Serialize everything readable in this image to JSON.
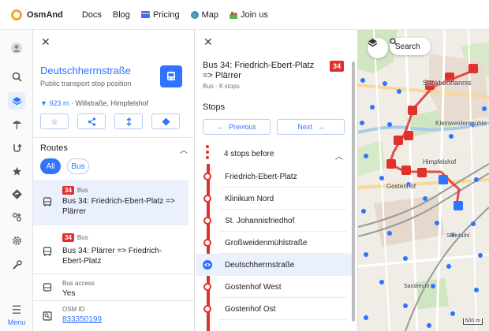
{
  "nav": {
    "brand": "OsmAnd",
    "links": [
      {
        "label": "Docs"
      },
      {
        "label": "Blog"
      },
      {
        "label": "Pricing"
      },
      {
        "label": "Map"
      },
      {
        "label": "Join us"
      }
    ]
  },
  "rail": {
    "menu_label": "Menu",
    "icons": [
      "account-icon",
      "search-icon",
      "layers-icon",
      "weather-icon",
      "route-icon",
      "favorite-icon",
      "navigation-icon",
      "plugins-icon",
      "settings-icon",
      "tools-icon"
    ]
  },
  "stop_panel": {
    "title": "Deutschherrnstraße",
    "subtitle": "Public transport stop position",
    "distance_value": "923 m",
    "distance_rest": " · Willstraße, Himpfelshof",
    "routes_heading": "Routes",
    "filter_all": "All",
    "filter_bus": "Bus",
    "routes": [
      {
        "badge": "34",
        "type": "Bus",
        "name_line1": "Bus 34: Friedrich-Ebert-Platz =>",
        "name_line2": "Plärrer"
      },
      {
        "badge": "34",
        "type": "Bus",
        "name_line1": "Bus 34: Plärrer => Friedrich-",
        "name_line2": "Ebert-Platz"
      }
    ],
    "properties": [
      {
        "label": "Bus access",
        "value": "Yes"
      },
      {
        "label": "OSM ID",
        "value": "833350199"
      }
    ]
  },
  "route_panel": {
    "title": "Bus 34: Friedrich-Ebert-Platz => Plärrer",
    "badge": "34",
    "meta": "Bus · 8 stops",
    "stops_heading": "Stops",
    "previous": "Previous",
    "next": "Next",
    "stops_before": "4 stops before",
    "stops": [
      {
        "name": "Friedrich-Ebert-Platz",
        "current": false
      },
      {
        "name": "Klinikum Nord",
        "current": false
      },
      {
        "name": "St. Johannisfriedhof",
        "current": false
      },
      {
        "name": "Großweidenmühlstraße",
        "current": false
      },
      {
        "name": "Deutschherrnstraße",
        "current": true
      },
      {
        "name": "Gostenhof West",
        "current": false
      },
      {
        "name": "Gostenhof Ost",
        "current": false
      }
    ]
  },
  "map": {
    "search_label": "Search",
    "labels": {
      "sankt_johannis": "Sankt Johannis",
      "kleinweidenmuehle": "Kleinweidenmühle",
      "himpfelshof": "Himpfelshof",
      "gostenhof": "Gostenhof",
      "steinbuhl": "Steinbühl",
      "sandreuth": "Sandreuth",
      "scale": "500 m"
    },
    "colors": {
      "route": "#e0302b",
      "stop": "#2f73ff",
      "accent": "#2f73ff"
    }
  }
}
